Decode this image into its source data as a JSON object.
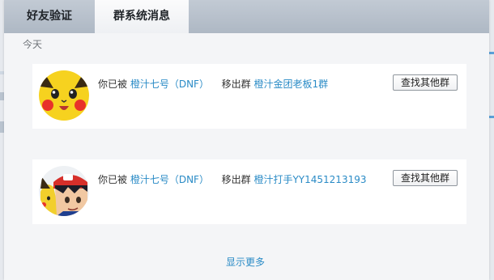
{
  "tabs": [
    {
      "label": "好友验证",
      "active": false
    },
    {
      "label": "群系统消息",
      "active": true
    }
  ],
  "date_label": "今天",
  "notifications": [
    {
      "avatar_icon": "pikachu-avatar-icon",
      "prefix": "你已被",
      "actor": "橙汁七号（DNF）",
      "action": "移出群",
      "group": "橙汁金团老板1群",
      "button": "查找其他群"
    },
    {
      "avatar_icon": "ash-pikachu-avatar-icon",
      "prefix": "你已被",
      "actor": "橙汁七号（DNF）",
      "action": "移出群",
      "group": "橙汁打手YY1451213193",
      "button": "查找其他群"
    }
  ],
  "show_more": "显示更多",
  "colors": {
    "link": "#2a8bc6",
    "tab_bar": "#b8c1cc",
    "card": "#ffffff",
    "panel": "#f4f5f7"
  }
}
